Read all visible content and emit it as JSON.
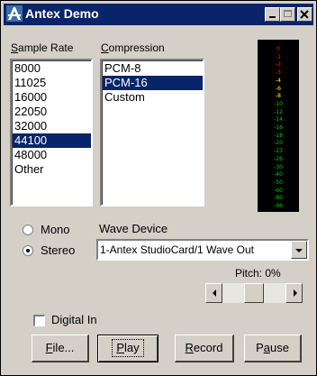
{
  "window": {
    "title": "Antex Demo"
  },
  "sample_rate": {
    "label_first": "S",
    "label_rest": "ample Rate",
    "items": [
      "8000",
      "11025",
      "16000",
      "22050",
      "32000",
      "44100",
      "48000",
      "Other"
    ],
    "selected": "44100"
  },
  "compression": {
    "label_first": "C",
    "label_rest": "ompression",
    "items": [
      "PCM-8",
      "PCM-16",
      "Custom"
    ],
    "selected": "PCM-16"
  },
  "meter": {
    "scale": [
      "0",
      "-1",
      "-2",
      "-3",
      "-4",
      "-6",
      "-8",
      "-10",
      "-12",
      "-14",
      "-16",
      "-18",
      "-20",
      "-23",
      "-26",
      "-30",
      "-40",
      "-50",
      "-60",
      "-80",
      "-96"
    ]
  },
  "channels": {
    "mono_label": "Mono",
    "stereo_label": "Stereo",
    "selected": "Stereo"
  },
  "wave_device": {
    "label": "Wave Device",
    "value": "1-Antex StudioCard/1 Wave Out"
  },
  "pitch": {
    "label": "Pitch: 0%",
    "value_percent": 0
  },
  "digital_in": {
    "label": "Digital In",
    "checked": false
  },
  "buttons": {
    "file": {
      "first": "F",
      "rest": "ile..."
    },
    "play": {
      "first": "P",
      "rest": "lay"
    },
    "record": {
      "first": "R",
      "rest": "ecord"
    },
    "pause": {
      "first": "P",
      "rest_prefix": "",
      "u_char": "a",
      "rest": "use"
    }
  },
  "colors": {
    "title_bar": "#0a246a",
    "selection": "#0a246a",
    "meter_red": "#ff2020",
    "meter_yellow": "#ffff00",
    "meter_green": "#00d000"
  }
}
